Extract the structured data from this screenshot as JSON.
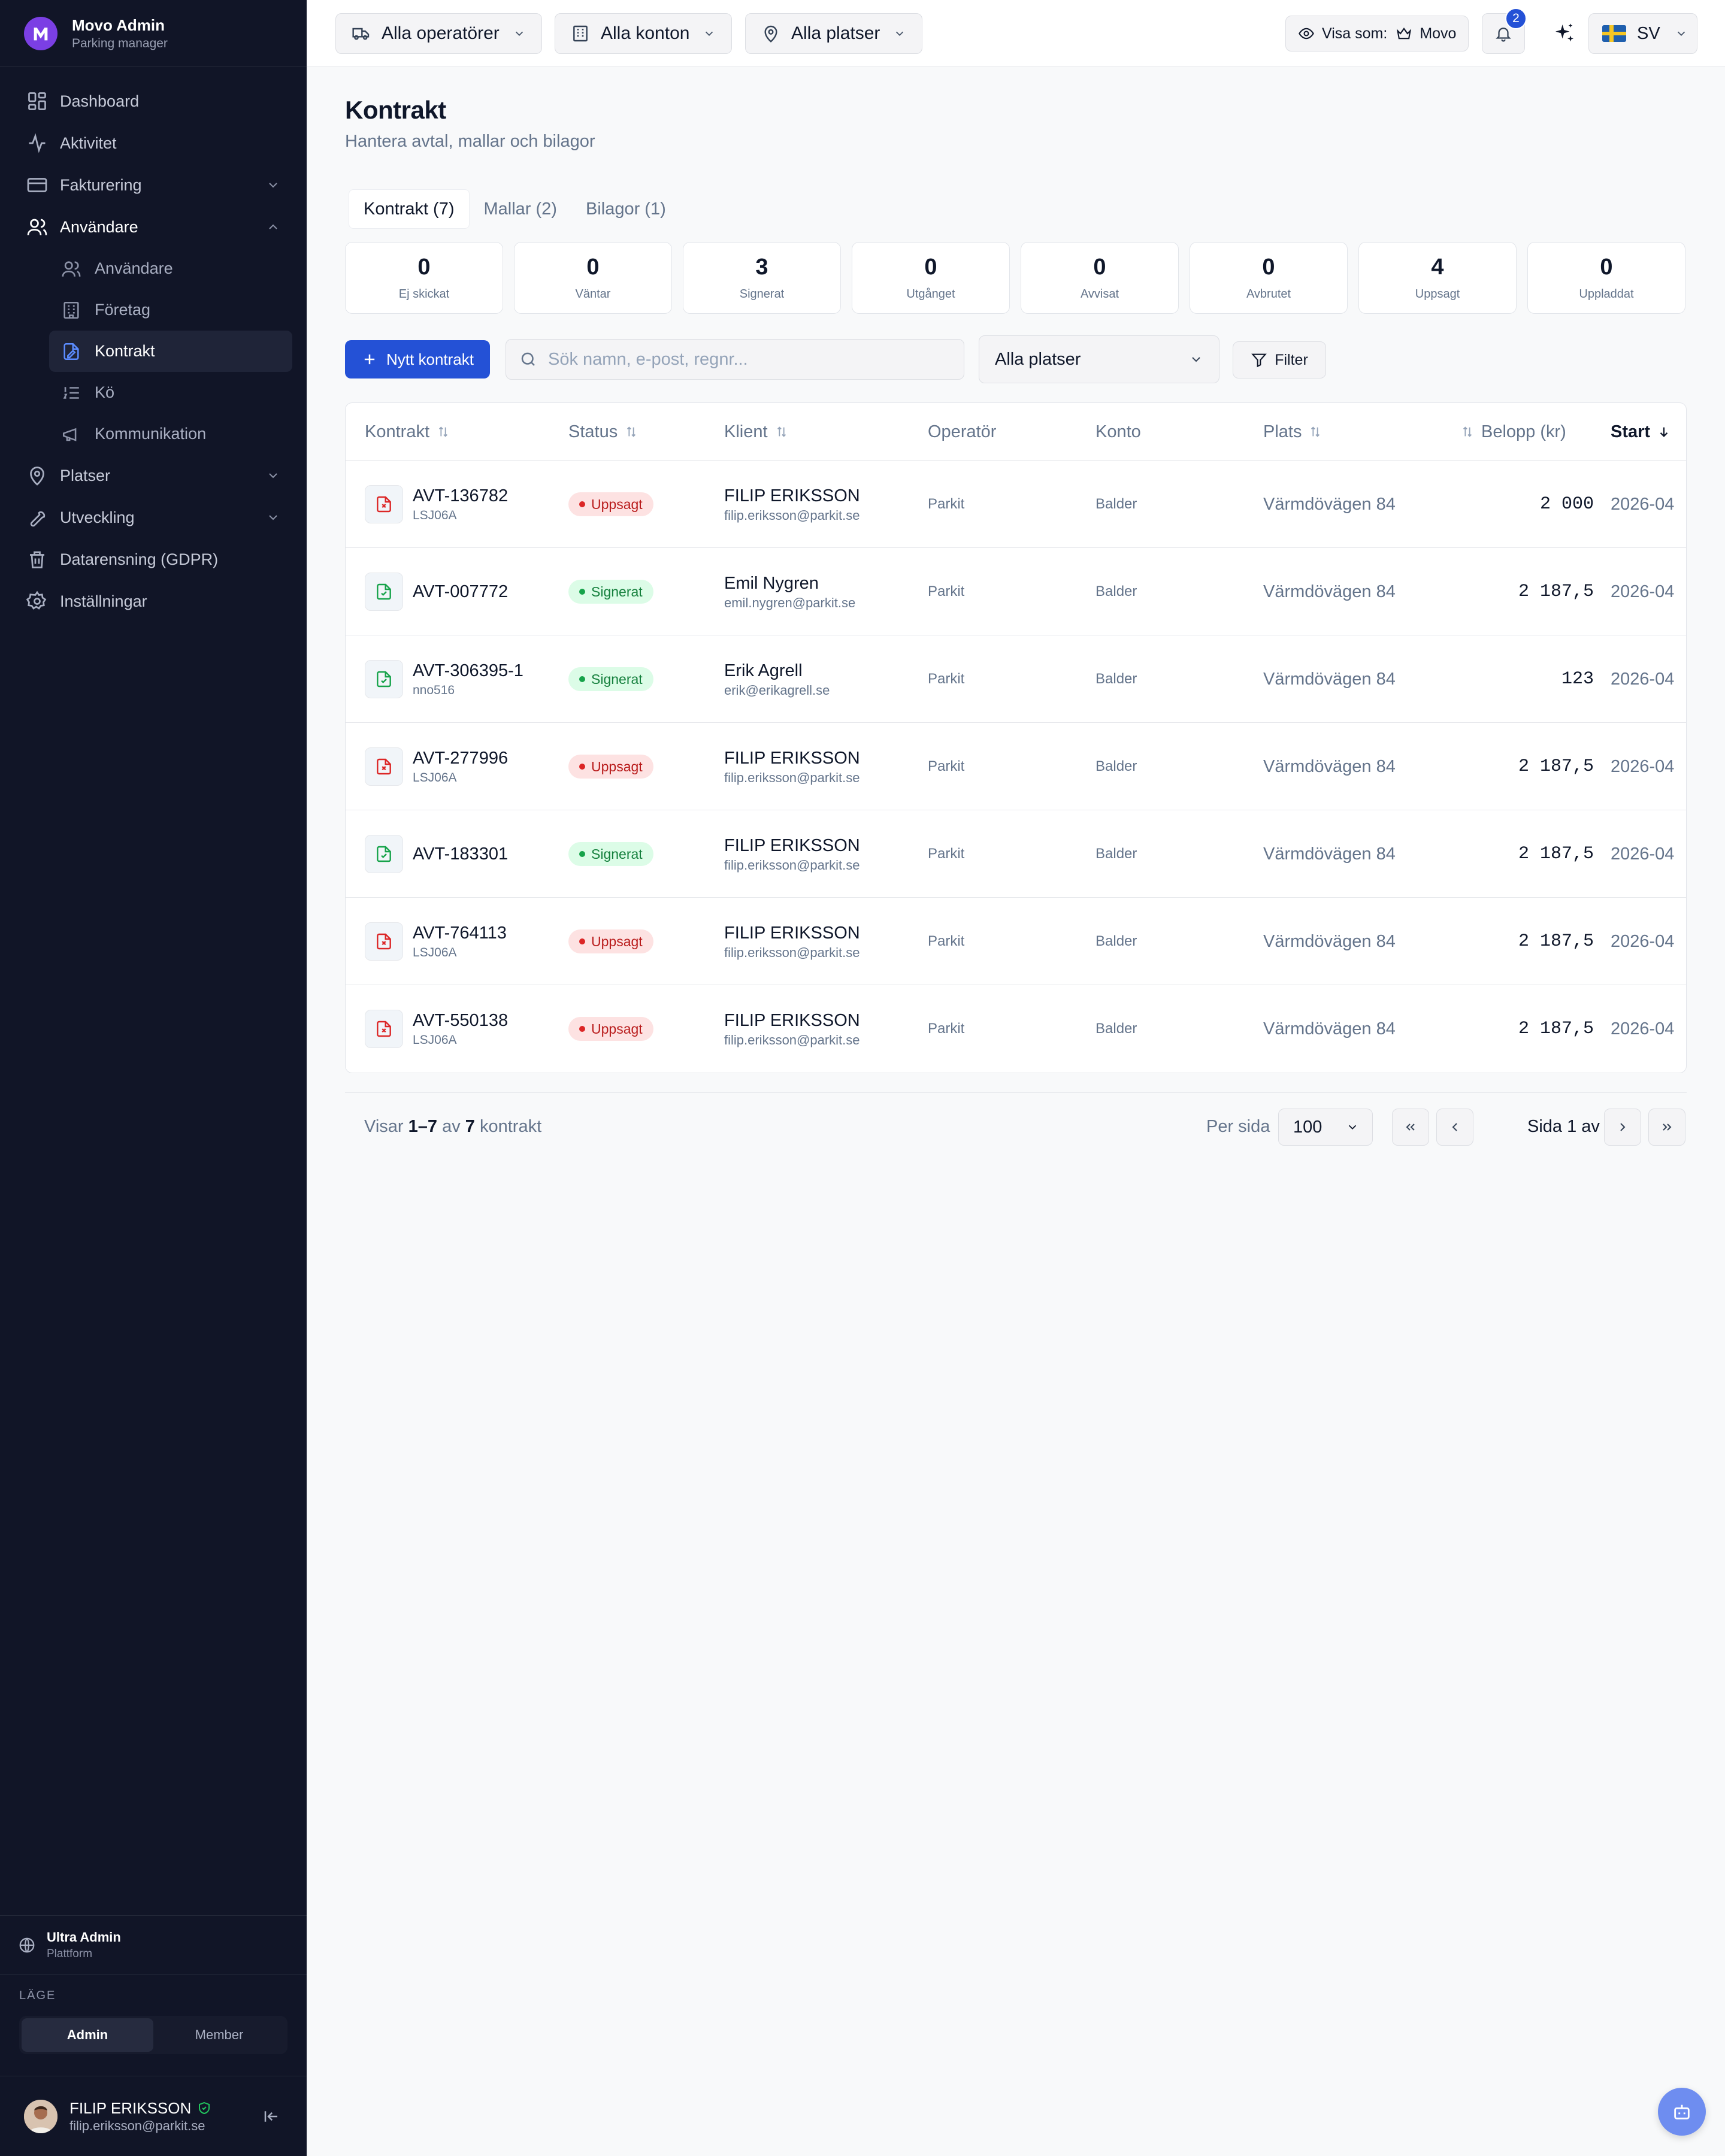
{
  "brand": {
    "name": "Movo Admin",
    "subtitle": "Parking manager",
    "logo_letter": "M",
    "accent": "#7b3fe4"
  },
  "nav": {
    "dashboard": "Dashboard",
    "aktivitet": "Aktivitet",
    "fakturering": "Fakturering",
    "anvandare": "Användare",
    "sub": {
      "anvandare": "Användare",
      "foretag": "Företag",
      "kontrakt": "Kontrakt",
      "ko": "Kö",
      "kommunikation": "Kommunikation"
    },
    "platser": "Platser",
    "utveckling": "Utveckling",
    "gdpr": "Datarensning (GDPR)",
    "installningar": "Inställningar"
  },
  "sidebar_footer": {
    "org_name": "Ultra Admin",
    "org_sub": "Plattform",
    "mode_label": "LÄGE",
    "mode_admin": "Admin",
    "mode_member": "Member",
    "user_name": "FILIP ERIKSSON",
    "user_email": "filip.eriksson@parkit.se"
  },
  "topbar": {
    "operators": "Alla operatörer",
    "accounts": "Alla konton",
    "places": "Alla platser",
    "view_as_label": "Visa som:",
    "view_as_value": "Movo",
    "notifications": "2",
    "language": "SV"
  },
  "page": {
    "title": "Kontrakt",
    "subtitle": "Hantera avtal, mallar och bilagor"
  },
  "tabs": {
    "kontrakt": "Kontrakt (7)",
    "mallar": "Mallar (2)",
    "bilagor": "Bilagor (1)"
  },
  "stats": [
    {
      "value": "0",
      "label": "Ej skickat"
    },
    {
      "value": "0",
      "label": "Väntar"
    },
    {
      "value": "3",
      "label": "Signerat"
    },
    {
      "value": "0",
      "label": "Utgånget"
    },
    {
      "value": "0",
      "label": "Avvisat"
    },
    {
      "value": "0",
      "label": "Avbrutet"
    },
    {
      "value": "4",
      "label": "Uppsagt"
    },
    {
      "value": "0",
      "label": "Uppladdat"
    }
  ],
  "toolbar": {
    "new_label": "Nytt kontrakt",
    "search_placeholder": "Sök namn, e-post, regnr...",
    "place_select": "Alla platser",
    "filter_label": "Filter"
  },
  "table": {
    "headers": {
      "kontrakt": "Kontrakt",
      "status": "Status",
      "klient": "Klient",
      "operator": "Operatör",
      "konto": "Konto",
      "plats": "Plats",
      "belopp": "Belopp (kr)",
      "start": "Start"
    },
    "rows": [
      {
        "id": "AVT-136782",
        "ref": "LSJ06A",
        "status": "Uppsagt",
        "client": "FILIP ERIKSSON",
        "email": "filip.eriksson@parkit.se",
        "operator": "Parkit",
        "account": "Balder",
        "place": "Värmdövägen 84",
        "amount": "2 000",
        "start": "2026-04"
      },
      {
        "id": "AVT-007772",
        "ref": "",
        "status": "Signerat",
        "client": "Emil Nygren",
        "email": "emil.nygren@parkit.se",
        "operator": "Parkit",
        "account": "Balder",
        "place": "Värmdövägen 84",
        "amount": "2 187,5",
        "start": "2026-04"
      },
      {
        "id": "AVT-306395-1",
        "ref": "nno516",
        "status": "Signerat",
        "client": "Erik Agrell",
        "email": "erik@erikagrell.se",
        "operator": "Parkit",
        "account": "Balder",
        "place": "Värmdövägen 84",
        "amount": "123",
        "start": "2026-04"
      },
      {
        "id": "AVT-277996",
        "ref": "LSJ06A",
        "status": "Uppsagt",
        "client": "FILIP ERIKSSON",
        "email": "filip.eriksson@parkit.se",
        "operator": "Parkit",
        "account": "Balder",
        "place": "Värmdövägen 84",
        "amount": "2 187,5",
        "start": "2026-04"
      },
      {
        "id": "AVT-183301",
        "ref": "",
        "status": "Signerat",
        "client": "FILIP ERIKSSON",
        "email": "filip.eriksson@parkit.se",
        "operator": "Parkit",
        "account": "Balder",
        "place": "Värmdövägen 84",
        "amount": "2 187,5",
        "start": "2026-04"
      },
      {
        "id": "AVT-764113",
        "ref": "LSJ06A",
        "status": "Uppsagt",
        "client": "FILIP ERIKSSON",
        "email": "filip.eriksson@parkit.se",
        "operator": "Parkit",
        "account": "Balder",
        "place": "Värmdövägen 84",
        "amount": "2 187,5",
        "start": "2026-04"
      },
      {
        "id": "AVT-550138",
        "ref": "LSJ06A",
        "status": "Uppsagt",
        "client": "FILIP ERIKSSON",
        "email": "filip.eriksson@parkit.se",
        "operator": "Parkit",
        "account": "Balder",
        "place": "Värmdövägen 84",
        "amount": "2 187,5",
        "start": "2026-04"
      }
    ]
  },
  "pagination": {
    "showing_prefix": "Visar",
    "range": "1–7",
    "of": "av",
    "total": "7",
    "suffix": "kontrakt",
    "per_page_label": "Per sida",
    "per_page": "100",
    "page_info": "Sida 1 av 1"
  },
  "colors": {
    "primary": "#2451d6",
    "sidebar_bg": "#111527",
    "uppsagt": "#dc2626",
    "signerat": "#16a34a"
  }
}
